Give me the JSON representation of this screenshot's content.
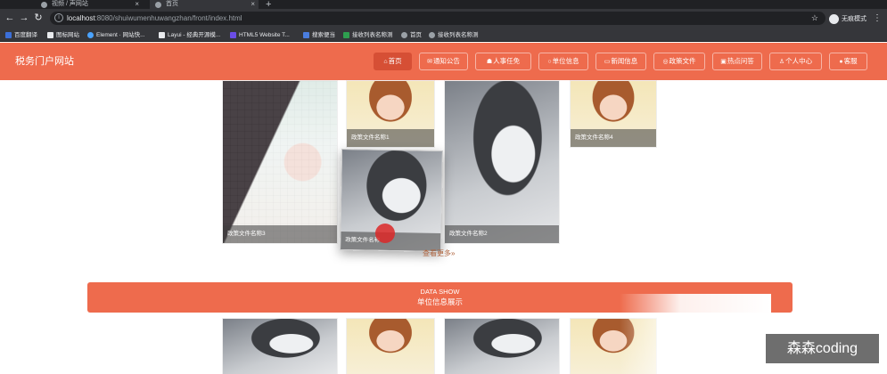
{
  "browser": {
    "tabs": [
      {
        "title": "视频 / 声网站",
        "active": false
      },
      {
        "title": "首页",
        "active": true
      }
    ],
    "new_tab": "+",
    "url_host": "localhost",
    "url_path": ":8080/shuiwumenhuwangzhan/front/index.html",
    "profile_label": "无痕模式",
    "bookmarks": [
      {
        "label": "百度翻译",
        "color": "#3b6fd8"
      },
      {
        "label": "图标网站",
        "color": "#e8eaed"
      },
      {
        "label": "Element · 网站快...",
        "color": "#4aa3ff"
      },
      {
        "label": "Layui - 经典开源模...",
        "color": "#e8eaed"
      },
      {
        "label": "HTML5 Website T...",
        "color": "#6b4de6"
      },
      {
        "label": "搜索便当",
        "color": "#4a7dde"
      },
      {
        "label": "接收列表名称测",
        "color": "#2e9e4f"
      },
      {
        "label": "首页",
        "color": "#9aa0a6"
      },
      {
        "label": "接收列表名称测",
        "color": "#9aa0a6"
      }
    ]
  },
  "site": {
    "title": "税务门户网站",
    "accent": "#ee6b4d",
    "nav": [
      {
        "label": "首页",
        "icon": "home-icon",
        "glyph": "⌂",
        "active": true
      },
      {
        "label": "通知公告",
        "icon": "bell-icon",
        "glyph": "✉",
        "active": false
      },
      {
        "label": "人事任免",
        "icon": "people-icon",
        "glyph": "☗",
        "active": false
      },
      {
        "label": "单位信息",
        "icon": "info-icon",
        "glyph": "○",
        "active": false
      },
      {
        "label": "新闻信息",
        "icon": "news-icon",
        "glyph": "▭",
        "active": false
      },
      {
        "label": "政策文件",
        "icon": "document-icon",
        "glyph": "◎",
        "active": false
      },
      {
        "label": "热点问答",
        "icon": "question-icon",
        "glyph": "▣",
        "active": false
      },
      {
        "label": "个人中心",
        "icon": "user-icon",
        "glyph": "♙",
        "active": false
      },
      {
        "label": "客服",
        "icon": "service-icon",
        "glyph": "●",
        "active": false
      }
    ]
  },
  "policy_cards": [
    {
      "caption": "政策文件名称3",
      "image": "anime-girl-image"
    },
    {
      "caption": "政策文件名称1",
      "image": "girl-photo-image"
    },
    {
      "caption": "政策文件名称2",
      "image": "husky-photo-image"
    },
    {
      "caption": "政策文件名称4",
      "image": "girl-photo-image"
    },
    {
      "caption": "政策文件名称",
      "image": "husky-photo-image"
    }
  ],
  "more_link": "查看更多»",
  "data_show": {
    "title": "DATA SHOW",
    "subtitle": "单位信息展示"
  },
  "watermark": "森森coding"
}
